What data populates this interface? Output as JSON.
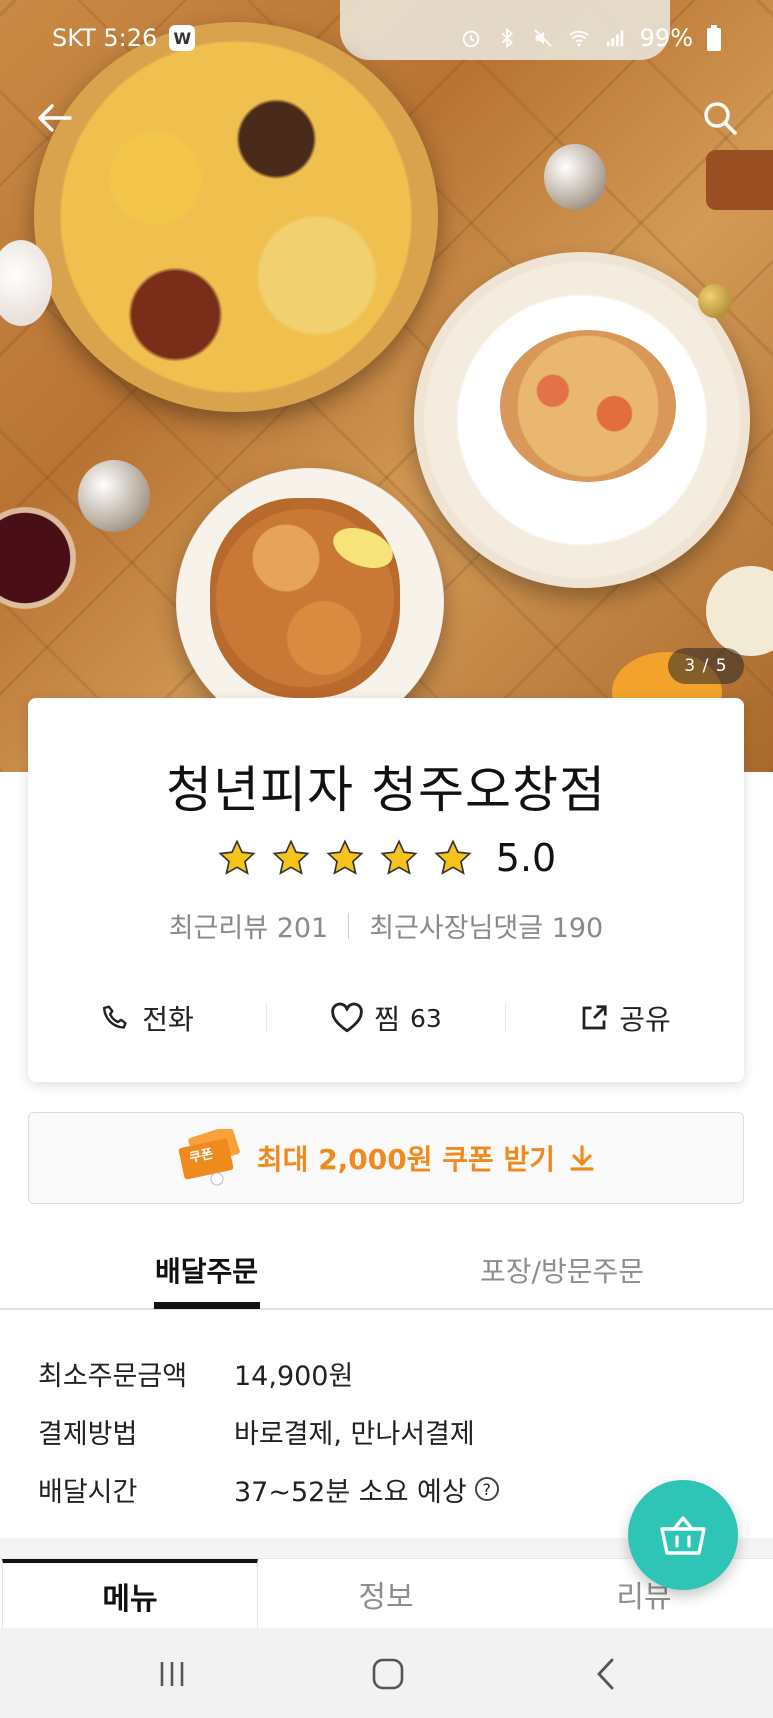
{
  "status_bar": {
    "carrier_time": "SKT 5:26",
    "app_badge": "W",
    "battery": "99%"
  },
  "hero": {
    "page_counter": "3 / 5"
  },
  "store": {
    "name": "청년피자 청주오창점",
    "rating": "5.0",
    "rating_stars": 5,
    "recent_reviews": "최근리뷰 201",
    "owner_replies": "최근사장님댓글 190"
  },
  "actions": {
    "call_label": "전화",
    "like_label": "찜",
    "like_count": "63",
    "share_label": "공유"
  },
  "coupon": {
    "ticket_label": "쿠폰",
    "text": "최대 2,000원 쿠폰 받기"
  },
  "order_tabs": {
    "delivery": "배달주문",
    "pickup": "포장/방문주문"
  },
  "delivery_info": [
    {
      "label": "최소주문금액",
      "value": "14,900원"
    },
    {
      "label": "결제방법",
      "value": "바로결제, 만나서결제"
    },
    {
      "label": "배달시간",
      "value": "37~52분 소요 예상"
    }
  ],
  "content_tabs": {
    "menu": "메뉴",
    "info": "정보",
    "review": "리뷰"
  },
  "colors": {
    "accent_orange": "#f08a1d",
    "fab_teal": "#2ec4b6",
    "star_yellow": "#f7c21b"
  },
  "icons": {
    "back": "arrow-left-icon",
    "search": "search-icon",
    "call": "phone-icon",
    "like": "heart-icon",
    "share": "share-icon",
    "download": "download-arrow-icon",
    "cart": "basket-icon",
    "help": "question-icon"
  }
}
